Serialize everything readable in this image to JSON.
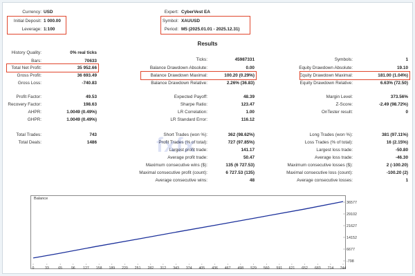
{
  "header": {
    "currency_label": "Currency:",
    "currency_value": "USD",
    "deposit_label": "Initial Deposit:",
    "deposit_value": "1 000.00",
    "leverage_label": "Leverage:",
    "leverage_value": "1:100",
    "expert_label": "Expert:",
    "expert_value": "CyberVest EA",
    "symbol_label": "Symbol:",
    "symbol_value": "XAUUSD",
    "period_label": "Period:",
    "period_value": "M5 (2025.01.01 - 2025.12.31)"
  },
  "results_title": "Results",
  "stats": {
    "history_quality": [
      "History Quality:",
      "0% real ticks"
    ],
    "bars": [
      "Bars:",
      "70633"
    ],
    "total_net_profit": [
      "Total Net Profit:",
      "35 952.66"
    ],
    "gross_profit": [
      "Gross Profit:",
      "36 693.49"
    ],
    "gross_loss": [
      "Gross Loss:",
      "-740.83"
    ],
    "profit_factor": [
      "Profit Factor:",
      "49.53"
    ],
    "recovery_factor": [
      "Recovery Factor:",
      "198.63"
    ],
    "ahpr": [
      "AHPR:",
      "1.0049 (0.49%)"
    ],
    "ghpr": [
      "GHPR:",
      "1.0049 (0.49%)"
    ],
    "total_trades": [
      "Total Trades:",
      "743"
    ],
    "total_deals": [
      "Total Deals:",
      "1486"
    ],
    "ticks": [
      "Ticks:",
      "45987331"
    ],
    "bal_dd_abs": [
      "Balance Drawdown Absolute:",
      "0.00"
    ],
    "bal_dd_max": [
      "Balance Drawdown Maximal:",
      "100.20 (0.29%)"
    ],
    "bal_dd_rel": [
      "Balance Drawdown Relative:",
      "2.26% (36.83)"
    ],
    "expected_payoff": [
      "Expected Payoff:",
      "48.39"
    ],
    "sharpe": [
      "Sharpe Ratio:",
      "123.47"
    ],
    "lr_corr": [
      "LR Correlation:",
      "1.00"
    ],
    "lr_err": [
      "LR Standard Error:",
      "116.12"
    ],
    "short_trades": [
      "Short Trades (won %):",
      "362 (98.62%)"
    ],
    "profit_trades": [
      "Profit Trades (% of total):",
      "727 (97.85%)"
    ],
    "largest_profit": [
      "Largest profit trade:",
      "141.17"
    ],
    "avg_profit": [
      "Average profit trade:",
      "50.47"
    ],
    "max_consec_wins": [
      "Maximum consecutive wins ($):",
      "135 (6 727.53)"
    ],
    "maximal_consec_profit": [
      "Maximal consecutive profit (count):",
      "6 727.53 (135)"
    ],
    "avg_consec_wins": [
      "Average consecutive wins:",
      "48"
    ],
    "symbols": [
      "Symbols:",
      "1"
    ],
    "eq_dd_abs": [
      "Equity Drawdown Absolute:",
      "19.10"
    ],
    "eq_dd_max": [
      "Equity Drawdown Maximal:",
      "181.00 (1.04%)"
    ],
    "eq_dd_rel": [
      "Equity Drawdown Relative:",
      "6.63% (72.50)"
    ],
    "margin_level": [
      "Margin Level:",
      "373.56%"
    ],
    "zscore": [
      "Z-Score:",
      "-2.49 (98.72%)"
    ],
    "ontester": [
      "OnTester result:",
      "0"
    ],
    "long_trades": [
      "Long Trades (won %):",
      "381 (97.11%)"
    ],
    "loss_trades": [
      "Loss Trades (% of total):",
      "16 (2.15%)"
    ],
    "largest_loss": [
      "Largest loss trade:",
      "-50.80"
    ],
    "avg_loss": [
      "Average loss trade:",
      "-46.30"
    ],
    "max_consec_losses": [
      "Maximum consecutive losses ($):",
      "2 (-100.20)"
    ],
    "maximal_consec_loss": [
      "Maximal consecutive loss (count):",
      "-100.20 (2)"
    ],
    "avg_consec_losses": [
      "Average consecutive losses:",
      "1"
    ]
  },
  "watermark": "fxfx",
  "chart_data": {
    "type": "line",
    "title": "Balance",
    "x_ticks": [
      "0",
      "33",
      "65",
      "96",
      "127",
      "158",
      "189",
      "220",
      "251",
      "282",
      "312",
      "343",
      "374",
      "405",
      "436",
      "467",
      "498",
      "529",
      "560",
      "591",
      "621",
      "652",
      "683",
      "714",
      "744"
    ],
    "y_ticks": [
      "36577",
      "29102",
      "21627",
      "14152",
      "6677",
      "-798"
    ],
    "xlim": [
      0,
      744
    ],
    "ylim": [
      -798,
      36577
    ],
    "series": [
      {
        "x": [
          0,
          60,
          150,
          250,
          350,
          450,
          550,
          650,
          744
        ],
        "y": [
          1000,
          3800,
          8300,
          13000,
          17800,
          22500,
          27300,
          32100,
          36953
        ]
      }
    ],
    "line_color": "#1a2f9a"
  }
}
